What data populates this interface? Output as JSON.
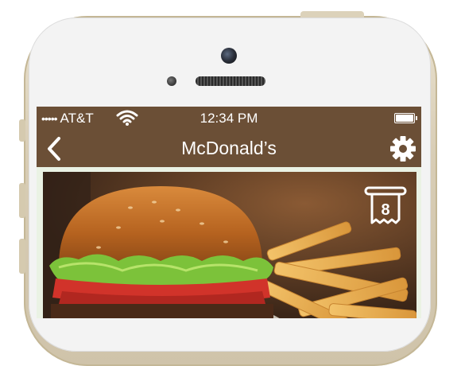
{
  "status_bar": {
    "signal": "•••••",
    "carrier": "AT&T",
    "time": "12:34 PM"
  },
  "nav": {
    "title": "McDonald’s"
  },
  "hero": {
    "badge_count": "8"
  },
  "colors": {
    "header_brown": "#6b4f36",
    "content_bg": "#eaf2e4",
    "phone_gold": "#d8cdb5"
  },
  "icons": [
    "back-chevron-icon",
    "gear-icon",
    "receipt-icon",
    "wifi-icon",
    "battery-icon"
  ]
}
